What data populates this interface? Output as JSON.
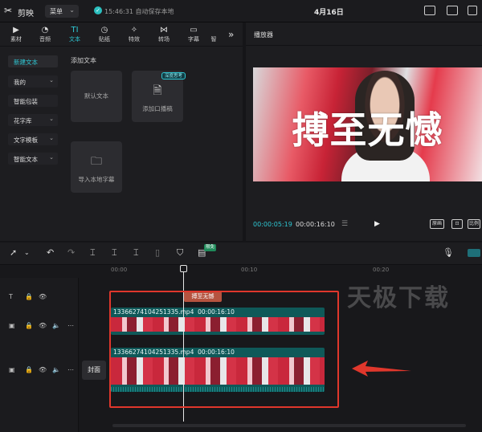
{
  "app": {
    "logo_icon": "scissors-logo-icon",
    "name": "剪映",
    "menu_label": "菜单",
    "save_status": "15:46:31 自动保存本地",
    "project_title": "4月16日"
  },
  "colors": {
    "accent": "#2ec7d3",
    "highlight_red": "#e0372c",
    "text_clip": "#b5533f",
    "video_clip": "#0f5959"
  },
  "tabs": [
    {
      "label": "素材",
      "icon": "media-icon"
    },
    {
      "label": "音频",
      "icon": "audio-icon"
    },
    {
      "label": "文本",
      "icon": "text-icon",
      "active": true
    },
    {
      "label": "贴纸",
      "icon": "sticker-icon"
    },
    {
      "label": "特效",
      "icon": "effects-icon"
    },
    {
      "label": "转场",
      "icon": "transition-icon"
    },
    {
      "label": "字幕",
      "icon": "caption-icon"
    },
    {
      "label": "智",
      "icon": "smart-icon"
    }
  ],
  "sidebar": {
    "items": [
      {
        "label": "新建文本",
        "active": true
      },
      {
        "label": "我的"
      },
      {
        "label": "智能包装"
      },
      {
        "label": "花字库"
      },
      {
        "label": "文字模板"
      },
      {
        "label": "智能文本"
      }
    ]
  },
  "text_panel": {
    "section_title": "添加文本",
    "default_card": "默认文本",
    "ai_card": "添加口播稿",
    "ai_badge": "深度思考",
    "import_card": "导入本地字幕"
  },
  "player": {
    "title": "播放器",
    "overlay_text": "搏至无憾",
    "current_time": "00:00:05:19",
    "total_time": "00:00:16:10",
    "original_label": "原画",
    "ratio_label": "比例"
  },
  "timeline": {
    "ai_badge": "限免",
    "ruler_labels": [
      "00:00",
      "00:10",
      "00:20"
    ],
    "cover_label": "封面",
    "text_clip": "搏至无憾",
    "clips": [
      {
        "name": "13366274104251335.mp4",
        "duration": "00:00:16:10"
      },
      {
        "name": "13366274104251335.mp4",
        "duration": "00:00:16:10"
      }
    ],
    "watermark": "天极下载"
  }
}
